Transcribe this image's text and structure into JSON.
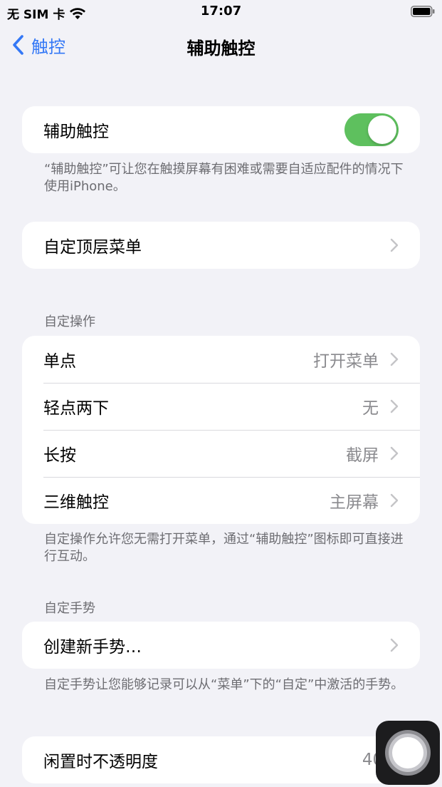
{
  "status_bar": {
    "carrier": "无 SIM 卡",
    "time": "17:07"
  },
  "nav": {
    "back_label": "触控",
    "title": "辅助触控"
  },
  "assistive_touch": {
    "label": "辅助触控",
    "enabled": true,
    "footer": "“辅助触控”可让您在触摸屏幕有困难或需要自适应配件的情况下使用iPhone。"
  },
  "top_menu": {
    "label": "自定顶层菜单"
  },
  "custom_actions": {
    "header": "自定操作",
    "rows": [
      {
        "label": "单点",
        "value": "打开菜单"
      },
      {
        "label": "轻点两下",
        "value": "无"
      },
      {
        "label": "长按",
        "value": "截屏"
      },
      {
        "label": "三维触控",
        "value": "主屏幕"
      }
    ],
    "footer": "自定操作允许您无需打开菜单，通过“辅助触控”图标即可直接进行互动。"
  },
  "custom_gestures": {
    "header": "自定手势",
    "create_label": "创建新手势…",
    "footer": "自定手势让您能够记录可以从“菜单”下的“自定”中激活的手势。"
  },
  "idle_opacity": {
    "label": "闲置时不透明度",
    "value": "40%"
  },
  "colors": {
    "accent": "#3478f6",
    "toggle_on": "#5ec05e",
    "background": "#f2f2f7"
  }
}
